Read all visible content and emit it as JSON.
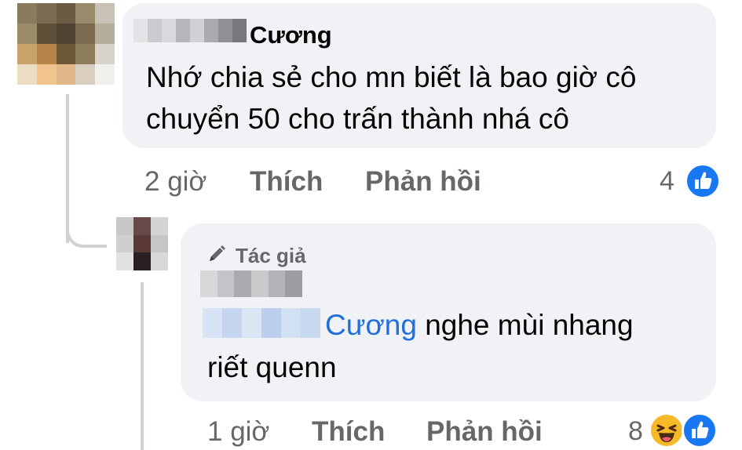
{
  "comment": {
    "author_visible": "Cương",
    "text": "Nhớ chia sẻ cho mn biết là bao giờ cô chuyển 50 cho trấn thành nhá cô",
    "text_line1": "Nhớ chia sẻ cho mn biết là bao giờ cô",
    "text_line2": "chuyển 50 cho trấn thành nhá cô",
    "time": "2 giờ",
    "like_label": "Thích",
    "reply_label": "Phản hồi",
    "reaction_count": "4",
    "reactions": [
      "like-icon"
    ]
  },
  "reply": {
    "badge_icon": "pencil-icon",
    "badge_label": "Tác giả",
    "mention": "Cương",
    "text_after_mention": " nghe mùi nhang",
    "text_line2": "riết quenn",
    "time": "1 giờ",
    "like_label": "Thích",
    "reply_label": "Phản hồi",
    "reaction_count": "8",
    "reactions": [
      "haha-icon",
      "like-icon"
    ]
  },
  "colors": {
    "bubble": "#f0f2f5",
    "meta_text": "#65676b",
    "mention": "#216fdb",
    "like_blue": "#1877f2",
    "haha_yellow": "#f7b928"
  }
}
